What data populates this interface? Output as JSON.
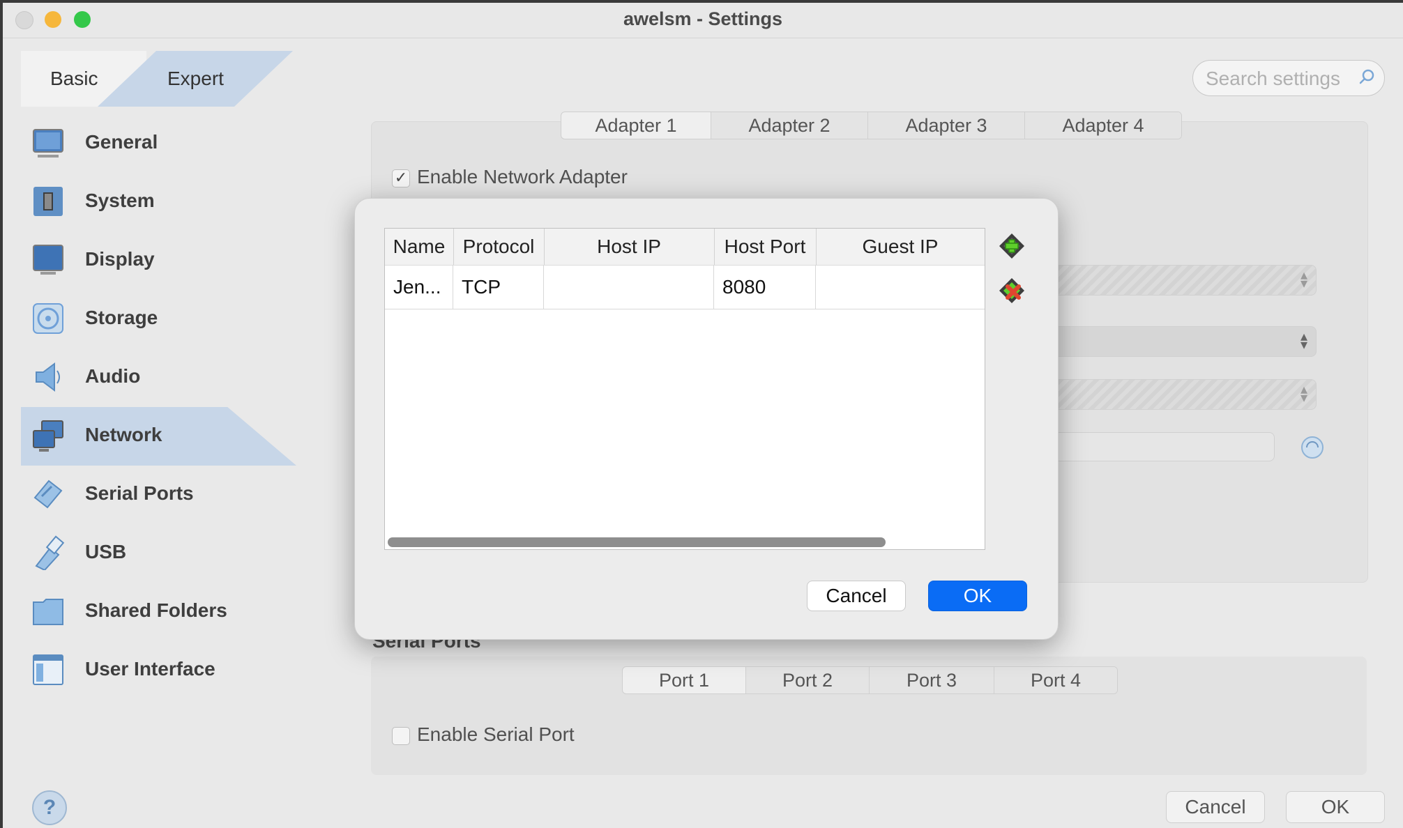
{
  "window": {
    "title": "awelsm - Settings"
  },
  "mode_tabs": {
    "basic": "Basic",
    "expert": "Expert"
  },
  "search": {
    "placeholder": "Search settings"
  },
  "sidebar": {
    "items": [
      {
        "label": "General",
        "icon": "general-icon"
      },
      {
        "label": "System",
        "icon": "system-icon"
      },
      {
        "label": "Display",
        "icon": "display-icon"
      },
      {
        "label": "Storage",
        "icon": "storage-icon"
      },
      {
        "label": "Audio",
        "icon": "audio-icon"
      },
      {
        "label": "Network",
        "icon": "network-icon",
        "selected": true
      },
      {
        "label": "Serial Ports",
        "icon": "serial-ports-icon"
      },
      {
        "label": "USB",
        "icon": "usb-icon"
      },
      {
        "label": "Shared Folders",
        "icon": "shared-folders-icon"
      },
      {
        "label": "User Interface",
        "icon": "user-interface-icon"
      }
    ]
  },
  "network": {
    "adapter_tabs": [
      "Adapter 1",
      "Adapter 2",
      "Adapter 3",
      "Adapter 4"
    ],
    "enable_adapter_label": "Enable Network Adapter",
    "enable_adapter_checked": true
  },
  "serial_ports": {
    "section_title": "Serial Ports",
    "port_tabs": [
      "Port 1",
      "Port 2",
      "Port 3",
      "Port 4"
    ],
    "enable_port_label": "Enable Serial Port",
    "enable_port_checked": false
  },
  "footer": {
    "help_symbol": "?",
    "cancel_label": "Cancel",
    "ok_label": "OK"
  },
  "port_forwarding_dialog": {
    "columns": [
      "Name",
      "Protocol",
      "Host IP",
      "Host Port",
      "Guest IP"
    ],
    "rows": [
      {
        "name": "Jen...",
        "protocol": "TCP",
        "host_ip": "",
        "host_port": "8080",
        "guest_ip": ""
      }
    ],
    "add_rule_icon": "add-rule-icon",
    "remove_rule_icon": "remove-rule-icon",
    "cancel_label": "Cancel",
    "ok_label": "OK",
    "accent_color": "#0a6cf5"
  }
}
